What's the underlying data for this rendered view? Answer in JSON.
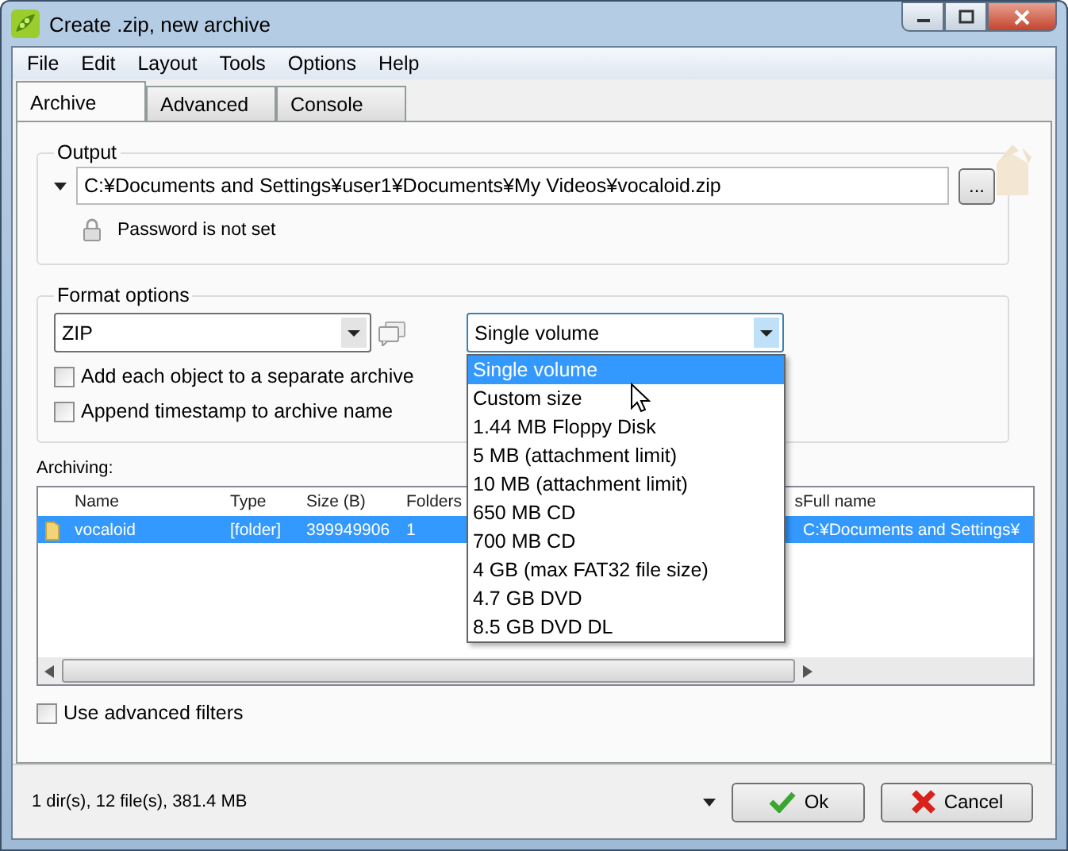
{
  "window": {
    "title": "Create .zip, new archive"
  },
  "menu": [
    "File",
    "Edit",
    "Layout",
    "Tools",
    "Options",
    "Help"
  ],
  "tabs": [
    {
      "label": "Archive",
      "selected": true
    },
    {
      "label": "Advanced",
      "selected": false
    },
    {
      "label": "Console",
      "selected": false
    }
  ],
  "output": {
    "legend": "Output",
    "path": "C:¥Documents and Settings¥user1¥Documents¥My Videos¥vocaloid.zip",
    "browse": "...",
    "password": "Password is not set"
  },
  "format": {
    "legend": "Format options",
    "archive_type": "ZIP",
    "volume": "Single volume",
    "checkboxes": [
      {
        "label": "Add each object to a separate archive",
        "checked": false
      },
      {
        "label": "Append timestamp to archive name",
        "checked": false
      }
    ],
    "volume_options": [
      {
        "label": "Single volume",
        "selected": true
      },
      {
        "label": "Custom size",
        "selected": false
      },
      {
        "label": "1.44 MB Floppy Disk",
        "selected": false
      },
      {
        "label": "5 MB (attachment limit)",
        "selected": false
      },
      {
        "label": "10 MB (attachment limit)",
        "selected": false
      },
      {
        "label": "650 MB CD",
        "selected": false
      },
      {
        "label": "700 MB CD",
        "selected": false
      },
      {
        "label": "4 GB (max FAT32 file size)",
        "selected": false
      },
      {
        "label": "4.7 GB DVD",
        "selected": false
      },
      {
        "label": "8.5 GB DVD DL",
        "selected": false
      }
    ]
  },
  "archiving": {
    "label": "Archiving:",
    "columns": [
      "Name",
      "Type",
      "Size (B)",
      "Folders",
      "s",
      "Full name"
    ],
    "rows": [
      {
        "cells": [
          "vocaloid",
          "[folder]",
          "399949906",
          "1",
          "",
          "C:¥Documents and Settings¥"
        ],
        "selected": true
      }
    ]
  },
  "advanced_filters": {
    "label": "Use advanced filters",
    "checked": false
  },
  "status": "1 dir(s), 12 file(s), 381.4 MB",
  "buttons": [
    {
      "label": "Ok",
      "kind": "ok"
    },
    {
      "label": "Cancel",
      "kind": "cancel"
    }
  ]
}
